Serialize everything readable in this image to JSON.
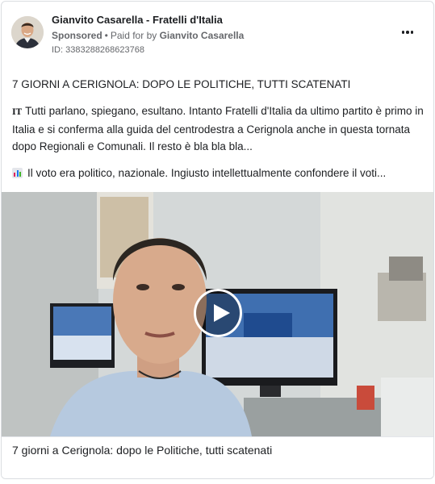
{
  "header": {
    "page_name": "Gianvito Casarella - Fratelli d'Italia",
    "sponsored_label": "Sponsored",
    "paid_for_label": "Paid for by",
    "payer": "Gianvito Casarella",
    "ad_id": "ID: 3383288268623768"
  },
  "post": {
    "headline": "7 GIORNI A CERIGNOLA: DOPO LE POLITICHE, TUTTI SCATENATI",
    "paragraph1_icon": "IT",
    "paragraph1": "Tutti parlano, spiegano, esultano. Intanto Fratelli d'Italia da ultimo partito è primo in Italia e si conferma alla guida del centrodestra a Cerignola anche in questa tornata dopo Regionali e Comunali. Il resto è bla bla bla...",
    "paragraph2_icon": "bar-chart-icon",
    "paragraph2": "Il voto era politico, nazionale. Ingiusto intellettualmente confondere il voti..."
  },
  "video": {
    "caption": "7 giorni a Cerignola: dopo le Politiche, tutti scatenati"
  },
  "colors": {
    "text": "#1c1e21",
    "secondary": "#65676b",
    "border": "#dadde1"
  }
}
